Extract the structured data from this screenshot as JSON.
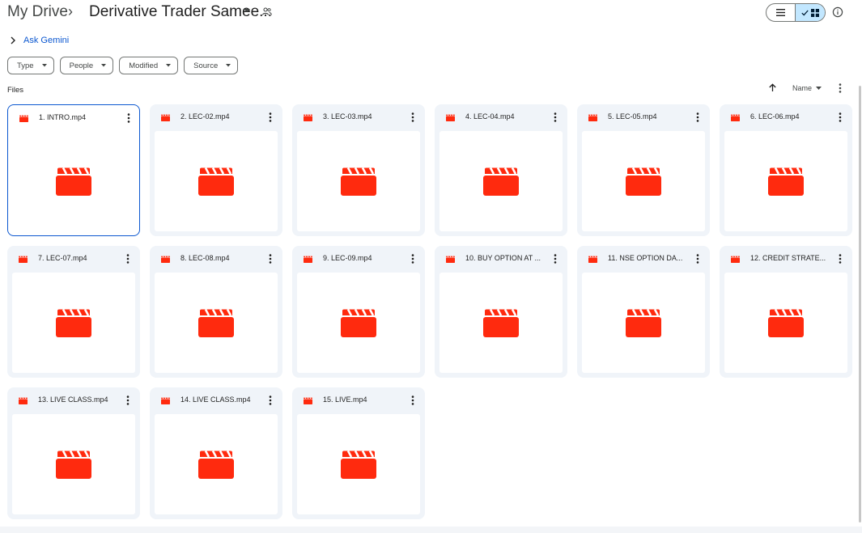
{
  "breadcrumb": {
    "root": "My Drive",
    "separator": "›",
    "current": "Derivative Trader Samee..."
  },
  "ask_gemini": {
    "label": "Ask Gemini"
  },
  "filters": [
    {
      "label": "Type"
    },
    {
      "label": "People"
    },
    {
      "label": "Modified"
    },
    {
      "label": "Source"
    }
  ],
  "section": {
    "files_label": "Files"
  },
  "sort": {
    "label": "Name"
  },
  "view": {
    "mode": "grid"
  },
  "colors": {
    "video_red": "#ff2a0e",
    "selection_blue": "#0b57d0",
    "toggle_active": "#c2e7ff"
  },
  "files": [
    {
      "name": "1. INTRO.mp4",
      "icon": "video-icon",
      "selected": true
    },
    {
      "name": "2. LEC-02.mp4",
      "icon": "video-icon"
    },
    {
      "name": "3. LEC-03.mp4",
      "icon": "video-icon"
    },
    {
      "name": "4. LEC-04.mp4",
      "icon": "video-icon"
    },
    {
      "name": "5. LEC-05.mp4",
      "icon": "video-icon"
    },
    {
      "name": "6. LEC-06.mp4",
      "icon": "video-icon"
    },
    {
      "name": "7. LEC-07.mp4",
      "icon": "video-icon"
    },
    {
      "name": "8. LEC-08.mp4",
      "icon": "video-icon"
    },
    {
      "name": "9. LEC-09.mp4",
      "icon": "video-icon"
    },
    {
      "name": "10. BUY OPTION AT ...",
      "icon": "video-icon"
    },
    {
      "name": "11. NSE OPTION DA...",
      "icon": "video-icon"
    },
    {
      "name": "12. CREDIT STRATE...",
      "icon": "video-icon"
    },
    {
      "name": "13. LIVE CLASS.mp4",
      "icon": "video-icon"
    },
    {
      "name": "14. LIVE CLASS.mp4",
      "icon": "video-icon"
    },
    {
      "name": "15. LIVE.mp4",
      "icon": "video-icon"
    }
  ]
}
